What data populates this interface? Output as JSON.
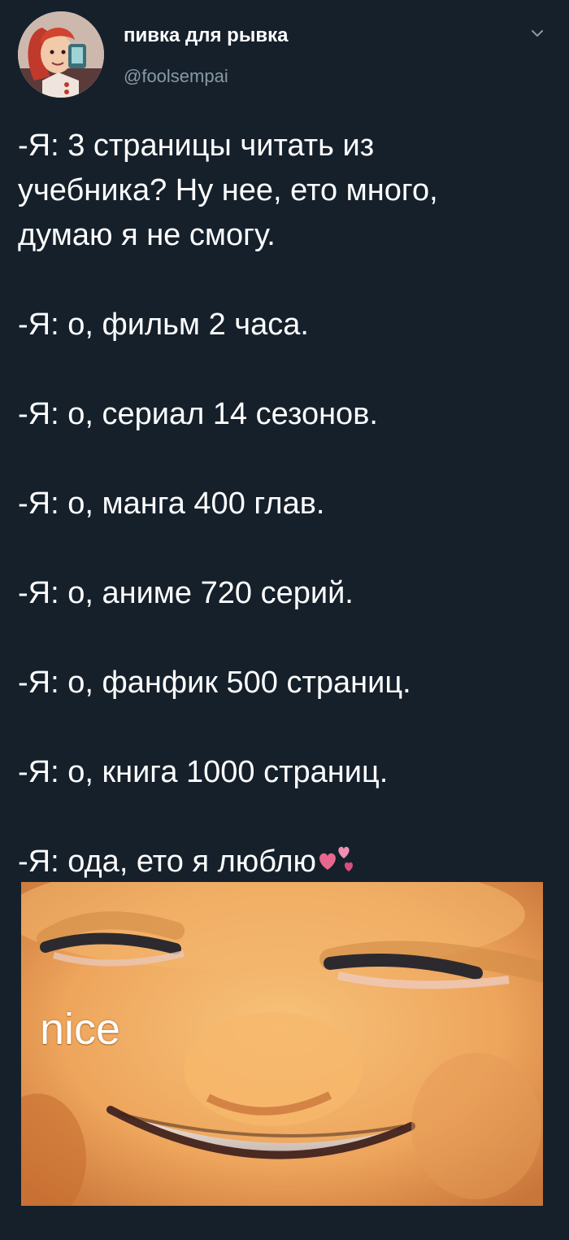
{
  "author": {
    "display_name": "пивка для рывка",
    "handle": "@foolsempai",
    "avatar_icon": "avatar-cartoon-girl-icon"
  },
  "menu_icon": "chevron-down-icon",
  "tweet": {
    "paragraphs": [
      [
        "-Я: 3 страницы читать из",
        "учебника? Ну нее, ето много,",
        "думаю я не смогу."
      ],
      [
        "-Я: о, фильм 2 часа."
      ],
      [
        "-Я: о, сериал 14 сезонов."
      ],
      [
        "-Я: о, манга 400 глав."
      ],
      [
        "-Я: о, аниме 720 серий."
      ],
      [
        "-Я: о, фанфик 500 страниц."
      ],
      [
        "-Я: о, книга 1000 страниц."
      ],
      [
        "-Я: ода, ето я люблю"
      ]
    ],
    "emoji_icon": "pink-hearts-icon"
  },
  "media": {
    "caption": "nice",
    "description_icon": "smiling-cartoon-face-image"
  },
  "colors": {
    "background": "#15202b",
    "text": "#ffffff",
    "muted": "#8899a6",
    "hearts": "#e8678f"
  }
}
